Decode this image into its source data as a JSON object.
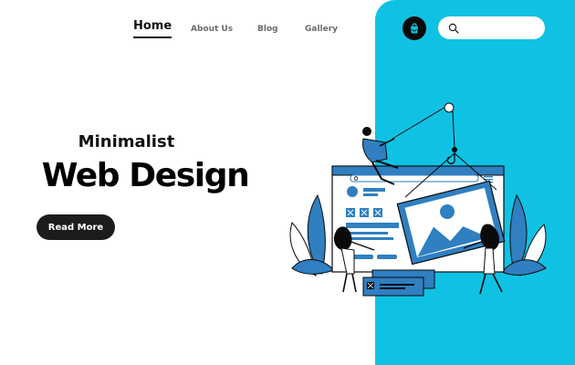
{
  "colors": {
    "accent": "#0fc2e3",
    "illustration_blue": "#2f7fc1",
    "dark": "#0a0a0a"
  },
  "nav": {
    "items": [
      {
        "label": "Home",
        "active": true
      },
      {
        "label": "About Us",
        "active": false
      },
      {
        "label": "Blog",
        "active": false
      },
      {
        "label": "Gallery",
        "active": false
      }
    ]
  },
  "header": {
    "cart_icon": "shopping-bag-icon",
    "search_icon": "search-icon",
    "search_value": ""
  },
  "hero": {
    "subtitle": "Minimalist",
    "title": "Web Design",
    "cta_label": "Read More"
  }
}
